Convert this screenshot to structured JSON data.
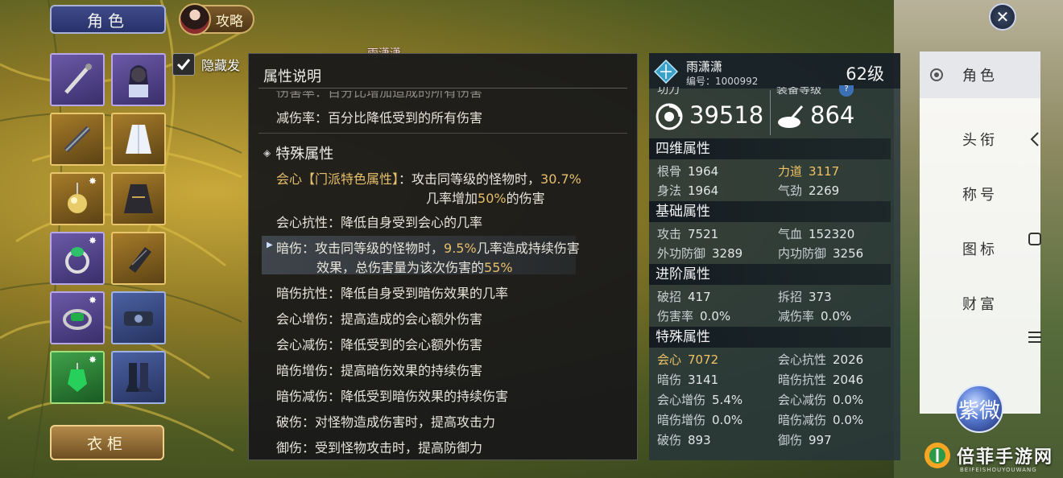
{
  "top": {
    "role_button": "角色",
    "guide_button": "攻略",
    "character_name_overlay": "雨潇潇"
  },
  "equipment": {
    "slots": [
      {
        "icon": "staff-weapon-icon",
        "rarity": "purple"
      },
      {
        "icon": "character-portrait-icon",
        "rarity": "purple"
      },
      {
        "icon": "flute-weapon-icon",
        "rarity": "gold"
      },
      {
        "icon": "white-robe-icon",
        "rarity": "gold"
      },
      {
        "icon": "pendant-icon",
        "rarity": "gold"
      },
      {
        "icon": "black-robe-icon",
        "rarity": "gold"
      },
      {
        "icon": "green-ring-icon",
        "rarity": "purple"
      },
      {
        "icon": "bracer-icon",
        "rarity": "gold"
      },
      {
        "icon": "jade-ring-icon",
        "rarity": "purple"
      },
      {
        "icon": "belt-icon",
        "rarity": "blue"
      },
      {
        "icon": "jade-pendant-icon",
        "rarity": "green"
      },
      {
        "icon": "boots-icon",
        "rarity": "blue"
      }
    ],
    "wardrobe_button": "衣柜"
  },
  "hide_hair": {
    "label": "隐藏发",
    "checked": true
  },
  "attr_popup": {
    "title": "属性说明",
    "faded_line": "伤害率：百分比增加造成的所有伤害",
    "reduce_line_key": "减伤率",
    "reduce_line_val": "：百分比降低受到的所有伤害",
    "section_title": "特殊属性",
    "crit_key": "会心【门派特色属性】",
    "crit_val_a": "：攻击同等级的怪物时，",
    "crit_pct": "30.7%",
    "crit_val_b": "几率增加",
    "crit_dmg": "50%",
    "crit_val_c": "的伤害",
    "crit_res_key": "会心抗性",
    "crit_res_val": "：降低自身受到会心的几率",
    "dark_key": "暗伤",
    "dark_val_a": "：攻击同等级的怪物时，",
    "dark_pct": "9.5%",
    "dark_val_b": "几率造成持续伤害",
    "dark_val_c": "效果，总伤害量为该次伤害的",
    "dark_total": "55%",
    "dark_res_key": "暗伤抗性",
    "dark_res_val": "：降低自身受到暗伤效果的几率",
    "crit_inc_key": "会心增伤",
    "crit_inc_val": "：提高造成的会心额外伤害",
    "crit_dec_key": "会心减伤",
    "crit_dec_val": "：降低受到的会心额外伤害",
    "dark_inc_key": "暗伤增伤",
    "dark_inc_val": "：提高暗伤效果的持续伤害",
    "dark_dec_key": "暗伤减伤",
    "dark_dec_val": "：降低受到暗伤效果的持续伤害",
    "break_key": "破伤",
    "break_val": "：对怪物造成伤害时，提高攻击力",
    "guard_key": "御伤",
    "guard_val": "：受到怪物攻击时，提高防御力"
  },
  "character": {
    "name": "雨潇潇",
    "id": "编号：1000992",
    "level": "62级",
    "power_label": "功力",
    "power_value": "39518",
    "equip_label": "装备等级",
    "equip_value": "864",
    "groups": {
      "four_dim": "四维属性",
      "basic": "基础属性",
      "advanced": "进阶属性",
      "special": "特殊属性"
    },
    "stats": {
      "gengu": {
        "n": "根骨",
        "v": "1964"
      },
      "lidao": {
        "n": "力道",
        "v": "3117"
      },
      "shenfa": {
        "n": "身法",
        "v": "1964"
      },
      "qijin": {
        "n": "气劲",
        "v": "2269"
      },
      "gongji": {
        "n": "攻击",
        "v": "7521"
      },
      "qixue": {
        "n": "气血",
        "v": "152320"
      },
      "waigong": {
        "n": "外功防御",
        "v": "3289"
      },
      "neigong": {
        "n": "内功防御",
        "v": "3256"
      },
      "pozhao": {
        "n": "破招",
        "v": "417"
      },
      "chaizhao": {
        "n": "拆招",
        "v": "373"
      },
      "shanghai": {
        "n": "伤害率",
        "v": "0.0%"
      },
      "jianshang": {
        "n": "减伤率",
        "v": "0.0%"
      },
      "huixin": {
        "n": "会心",
        "v": "7072"
      },
      "huixin_kx": {
        "n": "会心抗性",
        "v": "2026"
      },
      "anshang": {
        "n": "暗伤",
        "v": "3141"
      },
      "anshang_kx": {
        "n": "暗伤抗性",
        "v": "2046"
      },
      "hx_zs": {
        "n": "会心增伤",
        "v": "5.4%"
      },
      "hx_js": {
        "n": "会心减伤",
        "v": "0.0%"
      },
      "as_zs": {
        "n": "暗伤增伤",
        "v": "0.0%"
      },
      "as_js": {
        "n": "暗伤减伤",
        "v": "0.0%"
      },
      "poshang": {
        "n": "破伤",
        "v": "893"
      },
      "yushang": {
        "n": "御伤",
        "v": "997"
      }
    }
  },
  "sidebar": {
    "tabs": [
      "角色",
      "头衔",
      "称号",
      "图标",
      "财富"
    ]
  },
  "badge_text": "紫微",
  "watermark": {
    "text": "倍菲手游网",
    "sub": "BEIFEISHOUYOUWANG"
  },
  "colors": {
    "highlight": "#f0c264",
    "popup_bg": "#18181a",
    "panel_bg": "#26343c"
  }
}
